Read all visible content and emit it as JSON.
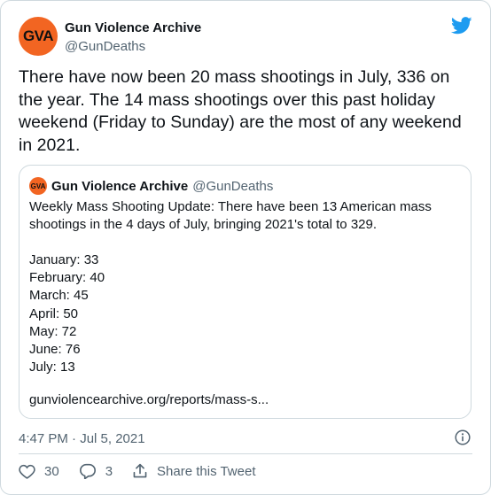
{
  "author": {
    "avatar_text": "GVA",
    "display_name": "Gun Violence Archive",
    "handle": "@GunDeaths"
  },
  "tweet": {
    "text": "There have now been 20 mass shootings in July, 336 on the year. The 14 mass shootings over this past holiday weekend (Friday to Sunday) are the most of any weekend in 2021.",
    "timestamp": "4:47 PM · Jul 5, 2021"
  },
  "quote": {
    "avatar_text": "GVA",
    "display_name": "Gun Violence Archive",
    "handle": "@GunDeaths",
    "intro": "Weekly Mass Shooting Update: There have been 13 American mass shootings in the 4 days of July, bringing 2021's total to 329.",
    "lines": [
      "January: 33",
      "February: 40",
      "March: 45",
      "April: 50",
      "May: 72",
      "June: 76",
      "July: 13"
    ],
    "link": "gunviolencearchive.org/reports/mass-s..."
  },
  "actions": {
    "likes": "30",
    "replies": "3",
    "share_label": "Share this Tweet"
  },
  "colors": {
    "brand_orange": "#f26522",
    "twitter_blue": "#1d9bf0",
    "muted": "#536471"
  },
  "icons": [
    "twitter-bird-icon",
    "info-icon",
    "heart-icon",
    "reply-icon",
    "share-icon"
  ]
}
